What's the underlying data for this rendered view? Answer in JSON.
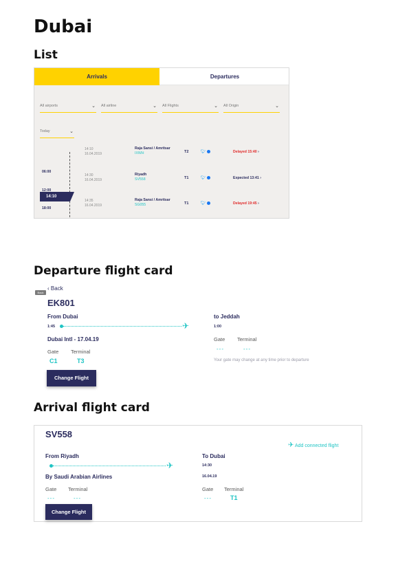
{
  "page": {
    "title": "Dubai",
    "section_list": "List",
    "section_departure": "Departure flight card",
    "section_arrival": "Arrival flight card"
  },
  "list": {
    "tabs": [
      {
        "label": "Arrivals",
        "active": true
      },
      {
        "label": "Departures",
        "active": false
      }
    ],
    "filters": [
      "All airports",
      "All airline",
      "All Flights",
      "All Origin"
    ],
    "date_filter": "Today",
    "timeline_labels": [
      "06:00",
      "12:00",
      "18:00"
    ],
    "current_time": "14:10",
    "rows": [
      {
        "time": "14:10",
        "date": "16.04.2019",
        "destination": "Raja Sansi / Amritsar",
        "flight": "IXWH",
        "terminal": "T2",
        "status": "Delayed 15:40",
        "status_type": "delayed"
      },
      {
        "time": "14:30",
        "date": "16.04.2019",
        "destination": "Riyadh",
        "flight": "SV558",
        "terminal": "T1",
        "status": "Expected 13:41",
        "status_type": "expected"
      },
      {
        "time": "14:35",
        "date": "16.04.2019",
        "destination": "Raja Sansi / Amritsar",
        "flight": "SG055",
        "terminal": "T1",
        "status": "Delayed 19:45",
        "status_type": "delayed"
      }
    ],
    "colors": {
      "accent": "#ffd200",
      "navy": "#2b2c5e",
      "teal": "#1fc4c4",
      "delayed": "#e02c2c"
    }
  },
  "departure": {
    "back_badge": "Back",
    "back_label": "Back",
    "flight_number": "EK801",
    "from_label": "From Dubai",
    "dep_time": "1:45",
    "airport_date": "Dubai Intl - 17.04.19",
    "gate_label": "Gate",
    "terminal_label": "Terminal",
    "gate_value": "C1",
    "terminal_value": "T3",
    "to_label": "to Jeddah",
    "arr_time": "1:00",
    "to_gate_label": "Gate",
    "to_terminal_label": "Terminal",
    "to_gate_value": "---",
    "to_terminal_value": "---",
    "note": "Your gate may change at any time prior to departure",
    "button": "Change Flight"
  },
  "arrival": {
    "flight_number": "SV558",
    "add_connected": "Add connected flight",
    "from_label": "From Riyadh",
    "airline": "By Saudi Arabian Airlines",
    "gate_label": "Gate",
    "terminal_label": "Terminal",
    "gate_value": "---",
    "terminal_value": "---",
    "to_label": "To Dubai",
    "arr_time": "14:30",
    "arr_date": "16.04.19",
    "to_gate_label": "Gate",
    "to_terminal_label": "Terminal",
    "to_gate_value": "---",
    "to_terminal_value": "T1",
    "button": "Change Flight"
  }
}
